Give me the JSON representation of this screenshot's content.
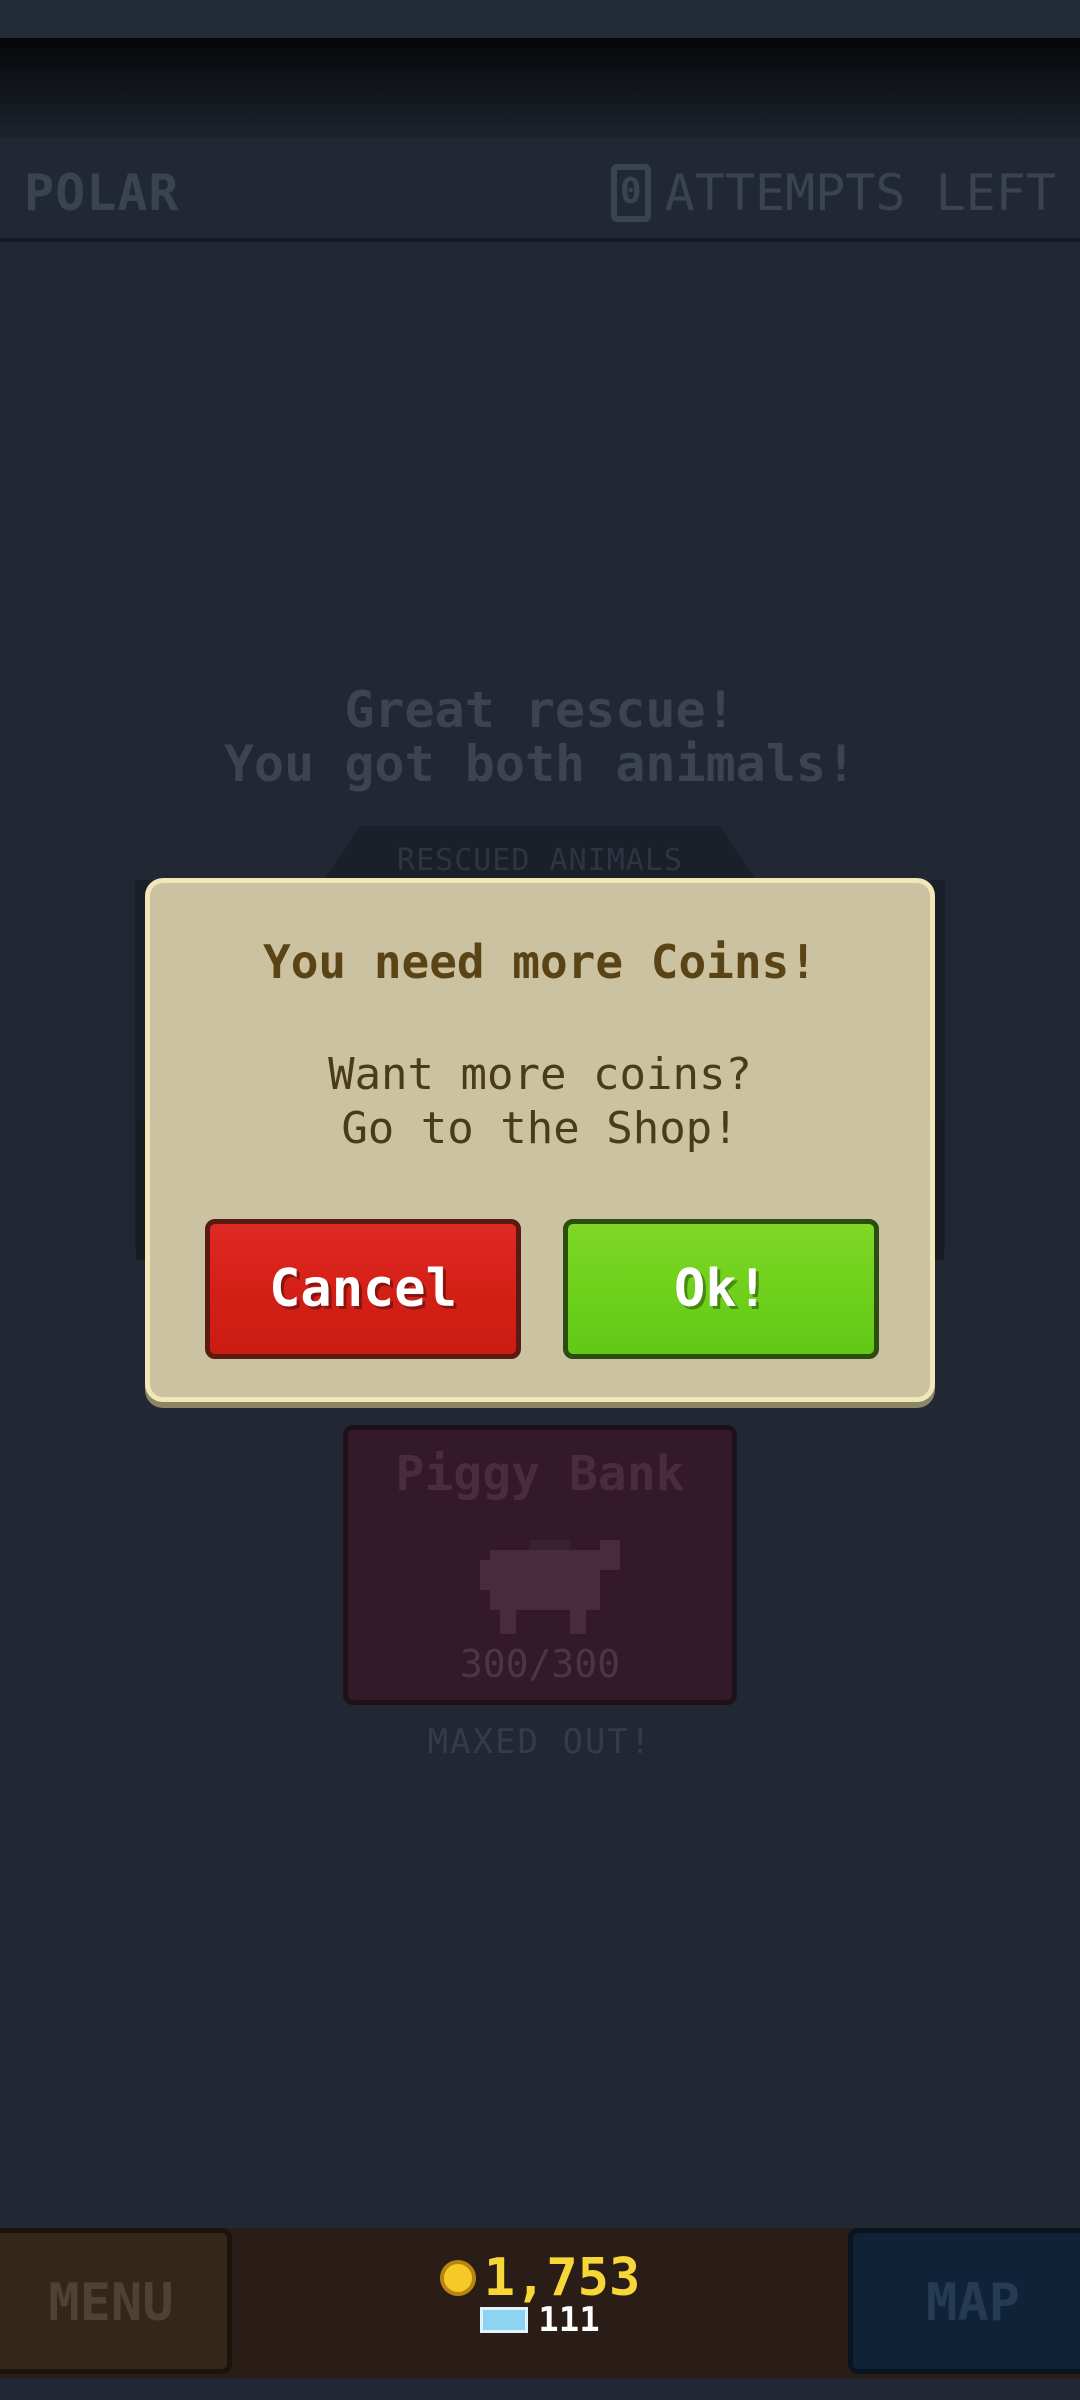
{
  "header": {
    "region": "POLAR",
    "attempts_count": "0",
    "attempts_label": "ATTEMPTS LEFT"
  },
  "background": {
    "rescue_line1": "Great rescue!",
    "rescue_line2": "You got both animals!",
    "rescued_tab": "RESCUED ANIMALS",
    "piggy_title": "Piggy Bank",
    "piggy_count": "300/300",
    "maxed": "MAXED OUT!"
  },
  "dialog": {
    "title": "You need more Coins!",
    "body_line1": "Want more coins?",
    "body_line2": "Go to the Shop!",
    "cancel_label": "Cancel",
    "ok_label": "Ok!"
  },
  "bottom": {
    "menu_label": "MENU",
    "map_label": "MAP",
    "coins": "1,753",
    "gems": "111"
  },
  "colors": {
    "cancel": "#d42017",
    "ok": "#6fd11b",
    "dialog_bg": "#cbc2a2",
    "coin": "#f7d737"
  },
  "icons": [
    "coin-icon",
    "gem-icon",
    "piggy-bank-icon"
  ]
}
